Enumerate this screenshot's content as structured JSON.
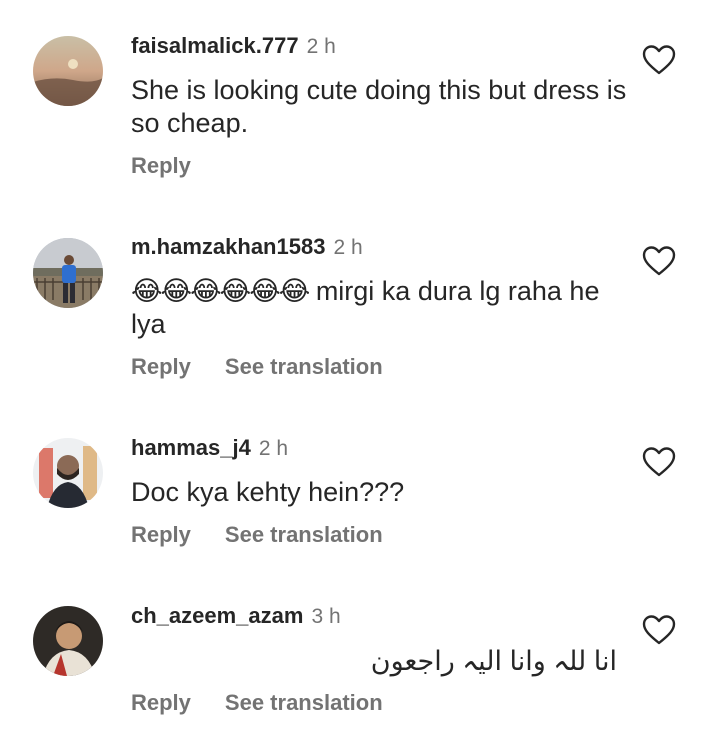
{
  "comments": [
    {
      "username": "faisalmalick.777",
      "time": "2 h",
      "text": "She is looking cute doing this but dress is so cheap.",
      "reply_label": "Reply",
      "translation_label": "",
      "avatar_icon": "sunset-photo-avatar",
      "like_icon": "heart-outline-icon"
    },
    {
      "username": "m.hamzakhan1583",
      "time": "2 h",
      "emoji": "😂😂😂😂😂😂",
      "text": "mirgi ka dura lg raha he lya",
      "reply_label": "Reply",
      "translation_label": "See translation",
      "avatar_icon": "person-outdoors-avatar",
      "like_icon": "heart-outline-icon"
    },
    {
      "username": "hammas_j4",
      "time": "2 h",
      "text": "Doc kya kehty hein???",
      "reply_label": "Reply",
      "translation_label": "See translation",
      "avatar_icon": "person-selfie-avatar",
      "like_icon": "heart-outline-icon"
    },
    {
      "username": "ch_azeem_azam",
      "time": "3 h",
      "text": "انا للہ وانا الیہ راجعون",
      "reply_label": "Reply",
      "translation_label": "See translation",
      "avatar_icon": "person-portrait-avatar",
      "like_icon": "heart-outline-icon"
    }
  ],
  "colors": {
    "primary_text": "#262626",
    "secondary_text": "#737373",
    "background": "#ffffff"
  }
}
